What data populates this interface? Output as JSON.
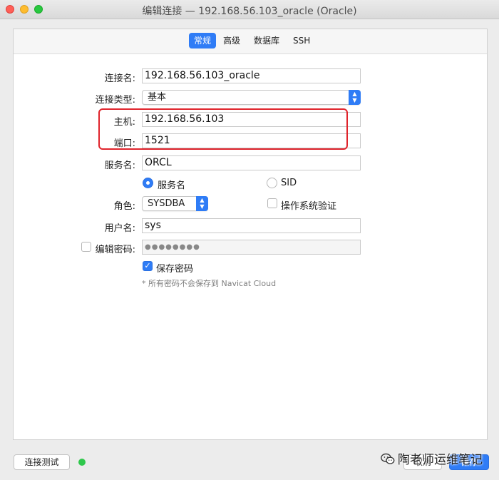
{
  "window": {
    "title": "编辑连接 — 192.168.56.103_oracle (Oracle)"
  },
  "tabs": [
    {
      "label": "常规",
      "active": true
    },
    {
      "label": "高级",
      "active": false
    },
    {
      "label": "数据库",
      "active": false
    },
    {
      "label": "SSH",
      "active": false
    }
  ],
  "form": {
    "connection_name": {
      "label": "连接名:",
      "value": "192.168.56.103_oracle"
    },
    "connection_type": {
      "label": "连接类型:",
      "value": "基本"
    },
    "host": {
      "label": "主机:",
      "value": "192.168.56.103"
    },
    "port": {
      "label": "端口:",
      "value": "1521"
    },
    "service_name": {
      "label": "服务名:",
      "value": "ORCL"
    },
    "service_type_options": [
      {
        "label": "服务名",
        "selected": true
      },
      {
        "label": "SID",
        "selected": false
      }
    ],
    "role": {
      "label": "角色:",
      "value": "SYSDBA"
    },
    "os_auth": {
      "label": "操作系统验证",
      "checked": false
    },
    "username": {
      "label": "用户名:",
      "value": "sys"
    },
    "edit_password": {
      "label": "编辑密码:",
      "checked": false,
      "value": "●●●●●●●●"
    },
    "save_password": {
      "label": "保存密码",
      "checked": true
    },
    "note": "* 所有密码不会保存到 Navicat Cloud"
  },
  "footer": {
    "test_button": "连接测试",
    "status_color": "#2fc84c",
    "cancel_button": "取消",
    "save_button": "保存"
  },
  "watermark": {
    "text": "陶老师运维笔记",
    "icon": "wechat-icon"
  },
  "colors": {
    "accent": "#2f7cf6",
    "highlight_box": "#e0242c"
  }
}
